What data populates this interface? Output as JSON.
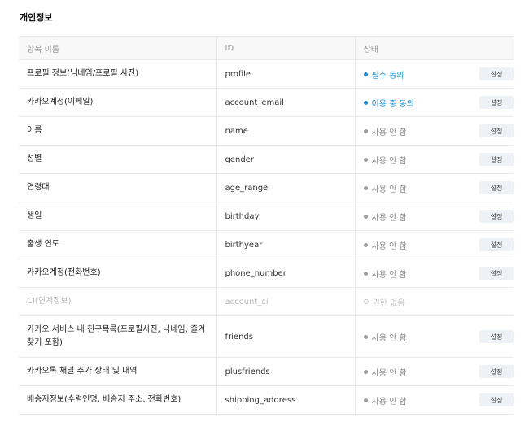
{
  "section": {
    "title": "개인정보"
  },
  "table": {
    "headers": {
      "name": "항목 이름",
      "id": "ID",
      "status": "상태"
    },
    "button_label": "설정",
    "rows": [
      {
        "name": "프로필 정보(닉네임/프로필 사진)",
        "id": "profile",
        "status": "필수 동의",
        "status_type": "required",
        "has_button": true
      },
      {
        "name": "카카오계정(이메일)",
        "id": "account_email",
        "status": "이용 중 동의",
        "status_type": "inuse",
        "has_button": true
      },
      {
        "name": "이름",
        "id": "name",
        "status": "사용 안 함",
        "status_type": "unused",
        "has_button": true
      },
      {
        "name": "성별",
        "id": "gender",
        "status": "사용 안 함",
        "status_type": "unused",
        "has_button": true
      },
      {
        "name": "연령대",
        "id": "age_range",
        "status": "사용 안 함",
        "status_type": "unused",
        "has_button": true
      },
      {
        "name": "생일",
        "id": "birthday",
        "status": "사용 안 함",
        "status_type": "unused",
        "has_button": true
      },
      {
        "name": "출생 연도",
        "id": "birthyear",
        "status": "사용 안 함",
        "status_type": "unused",
        "has_button": true
      },
      {
        "name": "카카오계정(전화번호)",
        "id": "phone_number",
        "status": "사용 안 함",
        "status_type": "unused",
        "has_button": true
      },
      {
        "name": "CI(연계정보)",
        "id": "account_ci",
        "status": "권한 없음",
        "status_type": "nopermission",
        "has_button": false
      },
      {
        "name": "카카오 서비스 내 친구목록(프로필사진, 닉네임, 즐겨찾기 포함)",
        "id": "friends",
        "status": "사용 안 함",
        "status_type": "unused",
        "has_button": true
      },
      {
        "name": "카카오톡 채널 추가 상태 및 내역",
        "id": "plusfriends",
        "status": "사용 안 함",
        "status_type": "unused",
        "has_button": true
      },
      {
        "name": "배송지정보(수령인명, 배송지 주소, 전화번호)",
        "id": "shipping_address",
        "status": "사용 안 함",
        "status_type": "unused",
        "has_button": true
      }
    ]
  }
}
